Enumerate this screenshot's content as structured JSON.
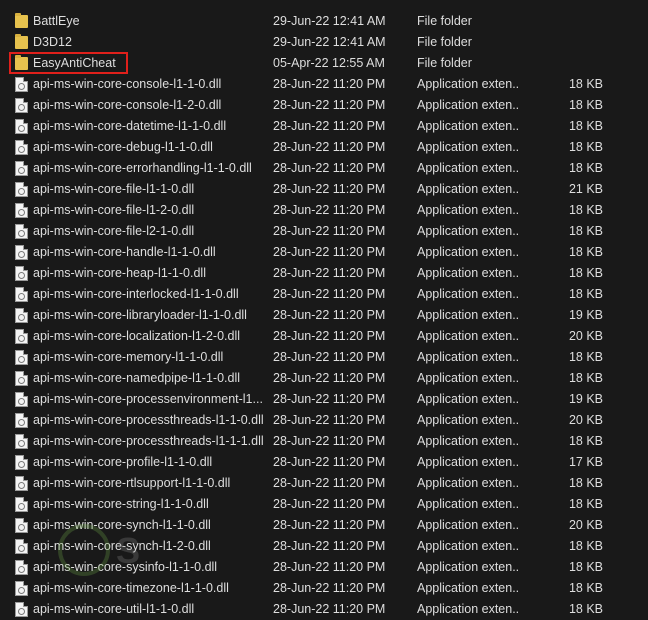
{
  "files": [
    {
      "kind": "folder",
      "name": "BattlEye",
      "date": "29-Jun-22 12:41 AM",
      "type": "File folder",
      "size": ""
    },
    {
      "kind": "folder",
      "name": "D3D12",
      "date": "29-Jun-22 12:41 AM",
      "type": "File folder",
      "size": ""
    },
    {
      "kind": "folder",
      "name": "EasyAntiCheat",
      "date": "05-Apr-22 12:55 AM",
      "type": "File folder",
      "size": "",
      "highlighted": true
    },
    {
      "kind": "dll",
      "name": "api-ms-win-core-console-l1-1-0.dll",
      "date": "28-Jun-22 11:20 PM",
      "type": "Application exten...",
      "size": "18 KB"
    },
    {
      "kind": "dll",
      "name": "api-ms-win-core-console-l1-2-0.dll",
      "date": "28-Jun-22 11:20 PM",
      "type": "Application exten...",
      "size": "18 KB"
    },
    {
      "kind": "dll",
      "name": "api-ms-win-core-datetime-l1-1-0.dll",
      "date": "28-Jun-22 11:20 PM",
      "type": "Application exten...",
      "size": "18 KB"
    },
    {
      "kind": "dll",
      "name": "api-ms-win-core-debug-l1-1-0.dll",
      "date": "28-Jun-22 11:20 PM",
      "type": "Application exten...",
      "size": "18 KB"
    },
    {
      "kind": "dll",
      "name": "api-ms-win-core-errorhandling-l1-1-0.dll",
      "date": "28-Jun-22 11:20 PM",
      "type": "Application exten...",
      "size": "18 KB"
    },
    {
      "kind": "dll",
      "name": "api-ms-win-core-file-l1-1-0.dll",
      "date": "28-Jun-22 11:20 PM",
      "type": "Application exten...",
      "size": "21 KB"
    },
    {
      "kind": "dll",
      "name": "api-ms-win-core-file-l1-2-0.dll",
      "date": "28-Jun-22 11:20 PM",
      "type": "Application exten...",
      "size": "18 KB"
    },
    {
      "kind": "dll",
      "name": "api-ms-win-core-file-l2-1-0.dll",
      "date": "28-Jun-22 11:20 PM",
      "type": "Application exten...",
      "size": "18 KB"
    },
    {
      "kind": "dll",
      "name": "api-ms-win-core-handle-l1-1-0.dll",
      "date": "28-Jun-22 11:20 PM",
      "type": "Application exten...",
      "size": "18 KB"
    },
    {
      "kind": "dll",
      "name": "api-ms-win-core-heap-l1-1-0.dll",
      "date": "28-Jun-22 11:20 PM",
      "type": "Application exten...",
      "size": "18 KB"
    },
    {
      "kind": "dll",
      "name": "api-ms-win-core-interlocked-l1-1-0.dll",
      "date": "28-Jun-22 11:20 PM",
      "type": "Application exten...",
      "size": "18 KB"
    },
    {
      "kind": "dll",
      "name": "api-ms-win-core-libraryloader-l1-1-0.dll",
      "date": "28-Jun-22 11:20 PM",
      "type": "Application exten...",
      "size": "19 KB"
    },
    {
      "kind": "dll",
      "name": "api-ms-win-core-localization-l1-2-0.dll",
      "date": "28-Jun-22 11:20 PM",
      "type": "Application exten...",
      "size": "20 KB"
    },
    {
      "kind": "dll",
      "name": "api-ms-win-core-memory-l1-1-0.dll",
      "date": "28-Jun-22 11:20 PM",
      "type": "Application exten...",
      "size": "18 KB"
    },
    {
      "kind": "dll",
      "name": "api-ms-win-core-namedpipe-l1-1-0.dll",
      "date": "28-Jun-22 11:20 PM",
      "type": "Application exten...",
      "size": "18 KB"
    },
    {
      "kind": "dll",
      "name": "api-ms-win-core-processenvironment-l1...",
      "date": "28-Jun-22 11:20 PM",
      "type": "Application exten...",
      "size": "19 KB"
    },
    {
      "kind": "dll",
      "name": "api-ms-win-core-processthreads-l1-1-0.dll",
      "date": "28-Jun-22 11:20 PM",
      "type": "Application exten...",
      "size": "20 KB"
    },
    {
      "kind": "dll",
      "name": "api-ms-win-core-processthreads-l1-1-1.dll",
      "date": "28-Jun-22 11:20 PM",
      "type": "Application exten...",
      "size": "18 KB"
    },
    {
      "kind": "dll",
      "name": "api-ms-win-core-profile-l1-1-0.dll",
      "date": "28-Jun-22 11:20 PM",
      "type": "Application exten...",
      "size": "17 KB"
    },
    {
      "kind": "dll",
      "name": "api-ms-win-core-rtlsupport-l1-1-0.dll",
      "date": "28-Jun-22 11:20 PM",
      "type": "Application exten...",
      "size": "18 KB"
    },
    {
      "kind": "dll",
      "name": "api-ms-win-core-string-l1-1-0.dll",
      "date": "28-Jun-22 11:20 PM",
      "type": "Application exten...",
      "size": "18 KB"
    },
    {
      "kind": "dll",
      "name": "api-ms-win-core-synch-l1-1-0.dll",
      "date": "28-Jun-22 11:20 PM",
      "type": "Application exten...",
      "size": "20 KB"
    },
    {
      "kind": "dll",
      "name": "api-ms-win-core-synch-l1-2-0.dll",
      "date": "28-Jun-22 11:20 PM",
      "type": "Application exten...",
      "size": "18 KB"
    },
    {
      "kind": "dll",
      "name": "api-ms-win-core-sysinfo-l1-1-0.dll",
      "date": "28-Jun-22 11:20 PM",
      "type": "Application exten...",
      "size": "18 KB"
    },
    {
      "kind": "dll",
      "name": "api-ms-win-core-timezone-l1-1-0.dll",
      "date": "28-Jun-22 11:20 PM",
      "type": "Application exten...",
      "size": "18 KB"
    },
    {
      "kind": "dll",
      "name": "api-ms-win-core-util-l1-1-0.dll",
      "date": "28-Jun-22 11:20 PM",
      "type": "Application exten...",
      "size": "18 KB"
    }
  ],
  "icons": {
    "folder": "folder-icon",
    "dll": "dll-file-icon"
  },
  "colors": {
    "background": "#191919",
    "text": "#dedede",
    "highlight": "#e0201b",
    "folder": "#e7c24e"
  }
}
